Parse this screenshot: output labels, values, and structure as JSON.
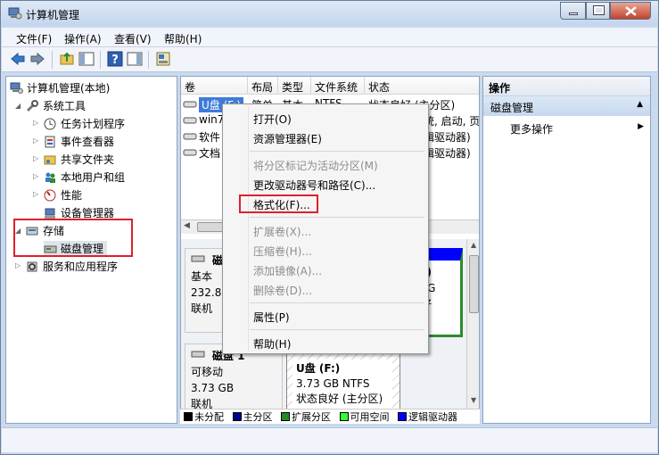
{
  "window": {
    "title": "计算机管理"
  },
  "menubar": {
    "items": [
      "文件(F)",
      "操作(A)",
      "查看(V)",
      "帮助(H)"
    ]
  },
  "tree": {
    "root": "计算机管理(本地)",
    "system_tools": "系统工具",
    "task_scheduler": "任务计划程序",
    "event_viewer": "事件查看器",
    "shared_folders": "共享文件夹",
    "local_users": "本地用户和组",
    "performance": "性能",
    "device_manager": "设备管理器",
    "storage": "存储",
    "disk_management": "磁盘管理",
    "services": "服务和应用程序"
  },
  "volume_list": {
    "columns": [
      "卷",
      "布局",
      "类型",
      "文件系统",
      "状态"
    ],
    "rows": [
      {
        "name": "U盘 (F:)",
        "layout": "简单",
        "type": "基本",
        "fs": "NTFS",
        "status": "状态良好 (主分区)"
      },
      {
        "name": "win7",
        "status": "统, 启动, 页"
      },
      {
        "name": "软件",
        "status": "辑驱动器)"
      },
      {
        "name": "文档",
        "status": "辑驱动器)"
      }
    ]
  },
  "disks": {
    "disk0": {
      "title": "磁盘 0",
      "kind": "基本",
      "size": "232.89",
      "state": "联机",
      "part_label": "(E:)",
      "part_size": "88 G",
      "part_status": "良好"
    },
    "disk1": {
      "title": "磁盘 1",
      "kind": "可移动",
      "size": "3.73 GB",
      "state": "联机",
      "part_title": "U盘  (F:)",
      "part_fs": "3.73 GB NTFS",
      "part_status": "状态良好 (主分区)"
    }
  },
  "legend": [
    {
      "label": "未分配",
      "color": "#000000"
    },
    {
      "label": "主分区",
      "color": "#00008b"
    },
    {
      "label": "扩展分区",
      "color": "#228b22"
    },
    {
      "label": "可用空间",
      "color": "#33ff33"
    },
    {
      "label": "逻辑驱动器",
      "color": "#0000ff"
    }
  ],
  "operations": {
    "header": "操作",
    "section": "磁盘管理",
    "more": "更多操作"
  },
  "context_menu": {
    "open": "打开(O)",
    "explorer": "资源管理器(E)",
    "mark_active": "将分区标记为活动分区(M)",
    "change_letter": "更改驱动器号和路径(C)...",
    "format": "格式化(F)...",
    "extend": "扩展卷(X)...",
    "shrink": "压缩卷(H)...",
    "add_mirror": "添加镜像(A)...",
    "delete": "删除卷(D)...",
    "properties": "属性(P)",
    "help": "帮助(H)"
  }
}
